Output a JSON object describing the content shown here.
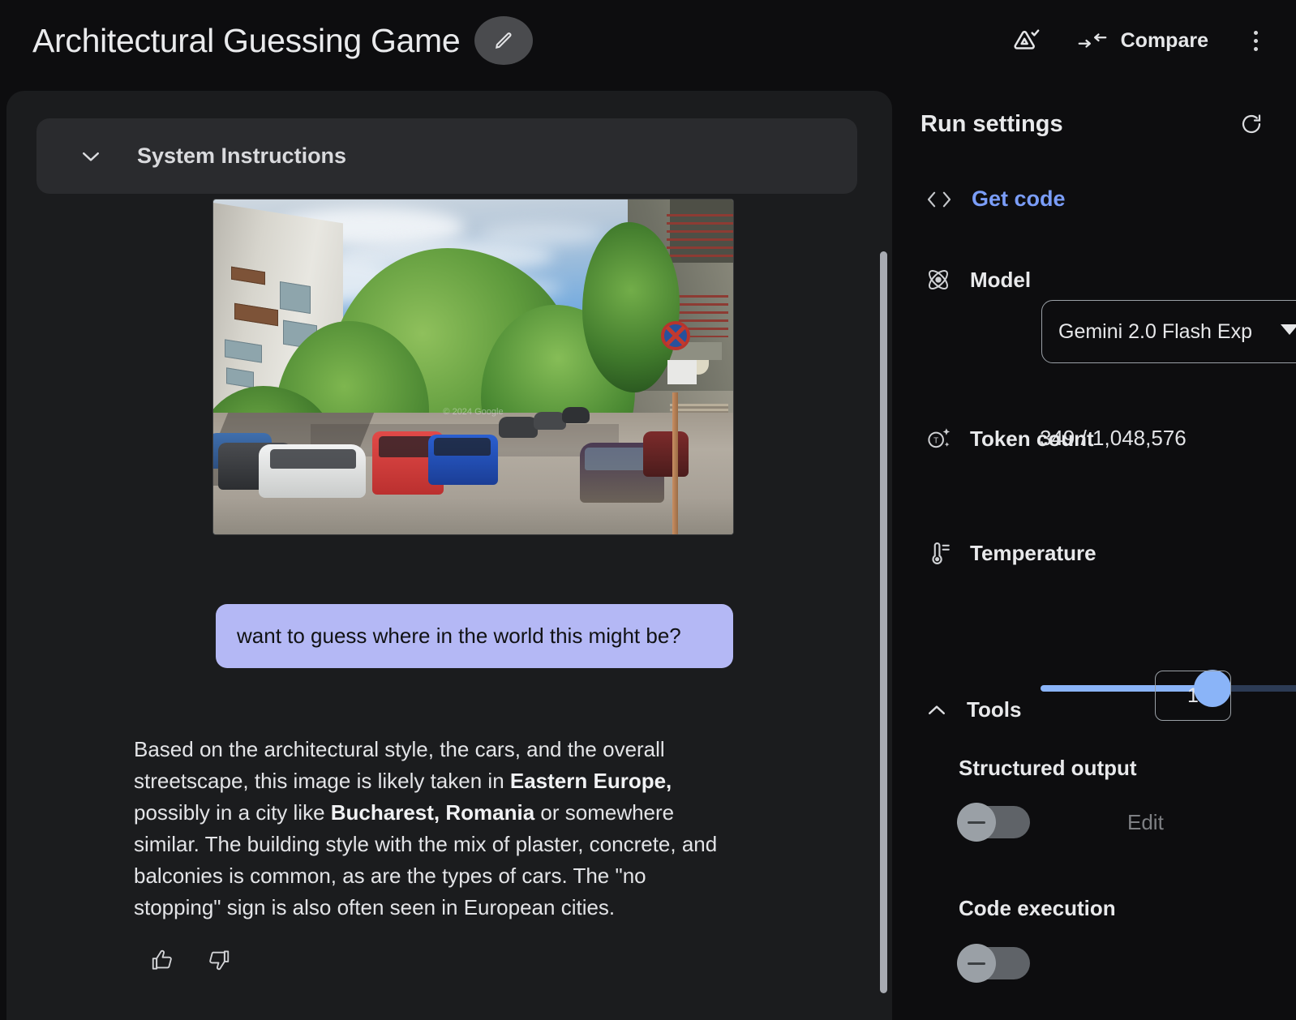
{
  "header": {
    "title": "Architectural Guessing Game",
    "edit_icon": "pencil-icon",
    "drive_save_icon": "drive-save-icon",
    "compare_icon": "compare-arrows-icon",
    "compare_label": "Compare",
    "more_icon": "kebab-menu-icon"
  },
  "main": {
    "system_instructions_label": "System Instructions",
    "system_instructions_expander_icon": "chevron-down-icon",
    "photo": {
      "alt": "street-view-photo",
      "watermark": "© 2024 Google"
    },
    "user_message": "want to guess where in the world this might be?",
    "response": {
      "part1": "Based on the architectural style, the cars, and the overall streetscape, this image is likely taken in ",
      "bold1": "Eastern Europe,",
      "part2": " possibly in a city like ",
      "bold2": "Bucharest, Romania",
      "part3": " or somewhere similar. The building style with the mix of plaster, concrete, and balconies is common, as are the types of cars. The \"no stopping\" sign is also often seen in European cities."
    },
    "thumbs_up_icon": "thumb-up-icon",
    "thumbs_down_icon": "thumb-down-icon"
  },
  "run_settings": {
    "title": "Run settings",
    "refresh_icon": "refresh-icon",
    "get_code_icon": "code-brackets-icon",
    "get_code_label": "Get code",
    "model": {
      "icon": "atom-model-icon",
      "label": "Model",
      "selected": "Gemini 2.0 Flash Exp",
      "caret_icon": "caret-down-icon"
    },
    "token_count": {
      "icon": "token-sparkle-icon",
      "label": "Token count",
      "value": "349 / 1,048,576"
    },
    "temperature": {
      "icon": "thermometer-icon",
      "label": "Temperature",
      "value": "1",
      "slider_percent": 50
    },
    "tools": {
      "label": "Tools",
      "expander_icon": "chevron-up-icon",
      "structured_output": {
        "label": "Structured output",
        "enabled": false,
        "edit_label": "Edit"
      },
      "code_execution": {
        "label": "Code execution",
        "enabled": false
      }
    }
  },
  "colors": {
    "accent_blue": "#7a9df8",
    "slider_blue": "#8ab4f8",
    "user_bubble": "#b4b8f5",
    "panel_bg": "#1b1c1e",
    "page_bg": "#0d0d0f"
  }
}
